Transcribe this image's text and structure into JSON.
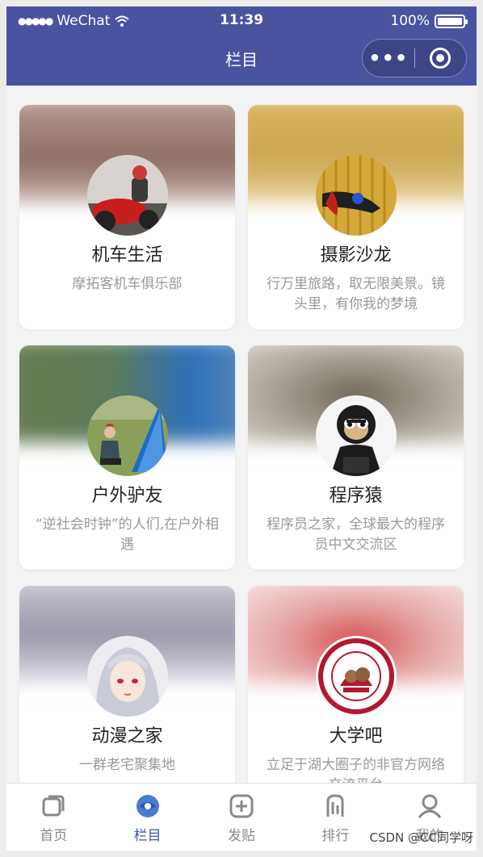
{
  "statusbar": {
    "carrier": "WeChat",
    "time": "11:39",
    "battery": "100%"
  },
  "navbar": {
    "title": "栏目",
    "more_icon": "ellipsis-icon",
    "close_icon": "target-icon"
  },
  "cards": [
    {
      "name": "机车生活",
      "desc": "摩拓客机车俱乐部",
      "bg": "#8c6c63"
    },
    {
      "name": "摄影沙龙",
      "desc": "行万里旅路，取无限美景。镜头里，有你我的梦境",
      "bg": "#caa54f"
    },
    {
      "name": "户外驴友",
      "desc": "“逆社会时钟”的人们,在户外相遇",
      "bg": "#5c7a5a"
    },
    {
      "name": "程序猿",
      "desc": "程序员之家，全球最大的程序员中文交流区",
      "bg": "#7a756c"
    },
    {
      "name": "动漫之家",
      "desc": "一群老宅聚集地",
      "bg": "#9a96a8"
    },
    {
      "name": "大学吧",
      "desc": "立足于湖大圈子的非官方网络交流平台",
      "bg": "#e7a8a8"
    }
  ],
  "tabbar": [
    {
      "label": "首页",
      "icon": "home-icon",
      "active": false
    },
    {
      "label": "栏目",
      "icon": "column-icon",
      "active": true
    },
    {
      "label": "发贴",
      "icon": "post-icon",
      "active": false
    },
    {
      "label": "排行",
      "icon": "rank-icon",
      "active": false
    },
    {
      "label": "我的",
      "icon": "profile-icon",
      "active": false
    }
  ],
  "watermark": "CSDN @CC同学呀",
  "colors": {
    "nav_bg": "#4a53a0",
    "tab_active": "#3a5aa6",
    "tab_inactive": "#888888"
  }
}
